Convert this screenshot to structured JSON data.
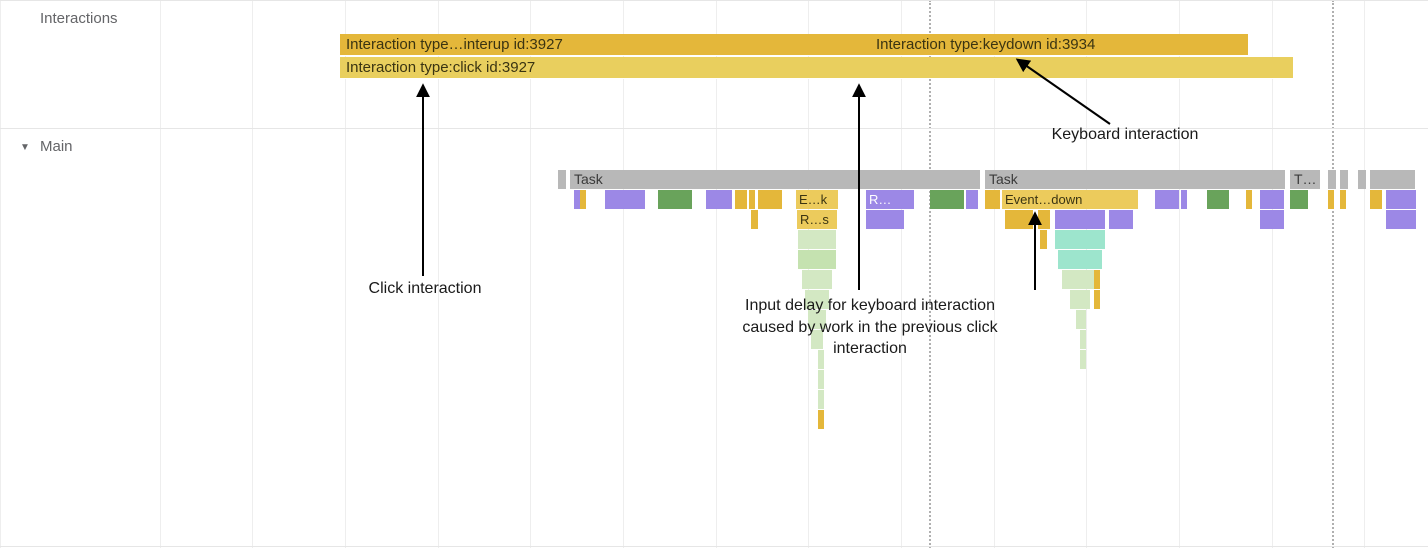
{
  "tracks": {
    "interactions_label": "Interactions",
    "main_label": "Main"
  },
  "interactions": {
    "pointerup": {
      "label": "Interaction type…interup id:3927"
    },
    "click": {
      "label": "Interaction type:click id:3927"
    },
    "keydown": {
      "label": "Interaction type:keydown id:3934"
    }
  },
  "main": {
    "task1_label": "Task",
    "task2_label": "Task",
    "task3_label": "T…",
    "event_ek": "E…k",
    "event_rdots": "R…",
    "event_rs": "R…s",
    "event_down": "Event…down"
  },
  "annotations": {
    "click_label": "Click interaction",
    "keyboard_label": "Keyboard interaction",
    "input_delay_label": "Input delay for keyboard interaction caused by work in the previous click interaction"
  }
}
